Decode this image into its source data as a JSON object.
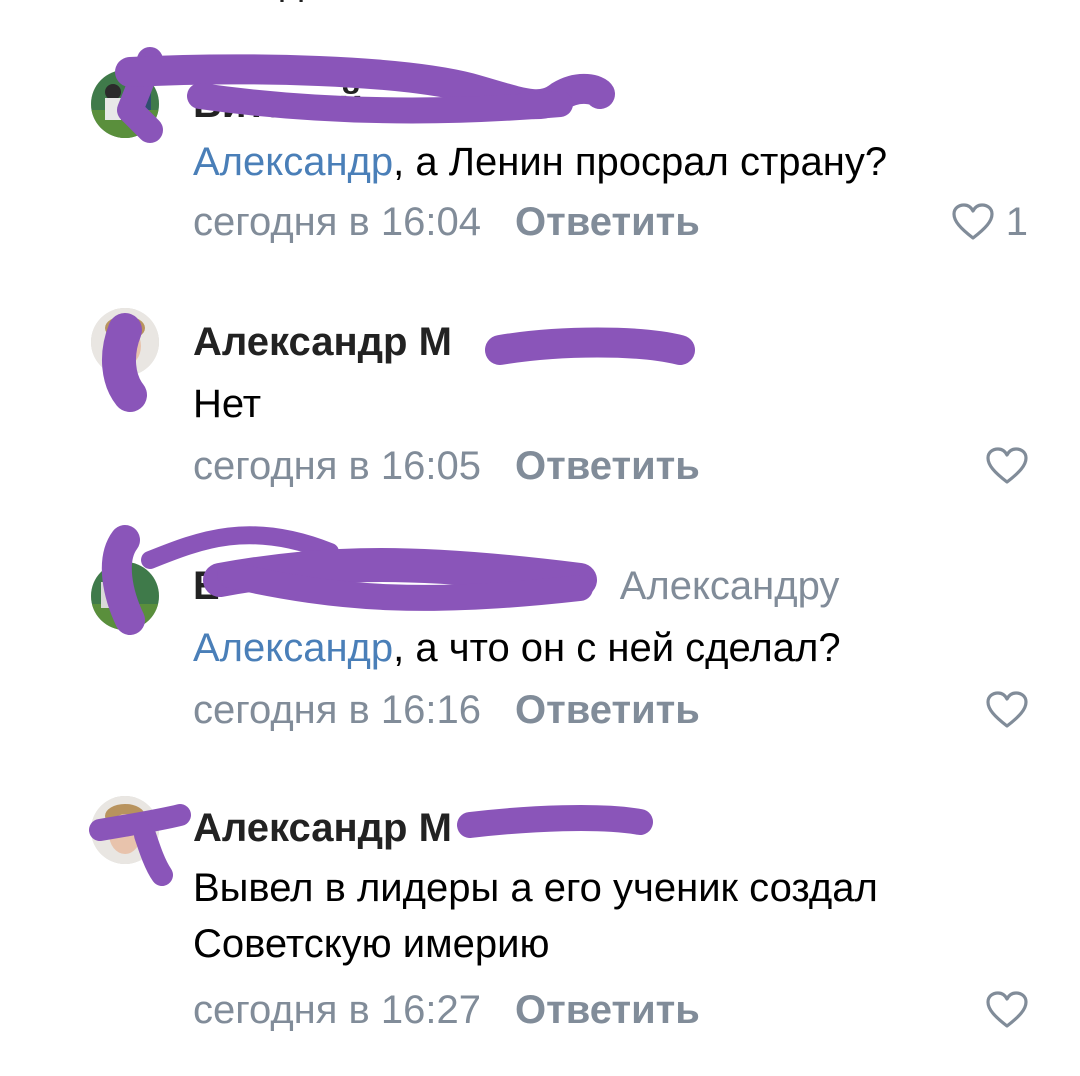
{
  "colors": {
    "mention": "#4a7fb8",
    "secondary": "#818c99",
    "text": "#000000",
    "author": "#222222",
    "redaction": "#8a55b9"
  },
  "top_fragment": "д",
  "comments": [
    {
      "author": "Виталий",
      "reply_to": "",
      "mention": "Александр",
      "text": ", а Ленин просрал страну?",
      "text_line2": "",
      "date": "сегодня в 16:04",
      "reply_label": "Ответить",
      "like_icon": "heart-icon",
      "likes": "1"
    },
    {
      "author": "Александр М",
      "reply_to": "",
      "mention": "",
      "text": "Нет",
      "text_line2": "",
      "date": "сегодня в 16:05",
      "reply_label": "Ответить",
      "like_icon": "heart-icon",
      "likes": ""
    },
    {
      "author": "Е",
      "reply_to": "Александру",
      "mention": "Александр",
      "text": ", а что он с ней сделал?",
      "text_line2": "",
      "date": "сегодня в 16:16",
      "reply_label": "Ответить",
      "like_icon": "heart-icon",
      "likes": ""
    },
    {
      "author": "Александр М",
      "reply_to": "",
      "mention": "",
      "text": "Вывел в лидеры а его ученик создал",
      "text_line2": "Советскую имерию",
      "date": "сегодня в 16:27",
      "reply_label": "Ответить",
      "like_icon": "heart-icon",
      "likes": ""
    }
  ]
}
